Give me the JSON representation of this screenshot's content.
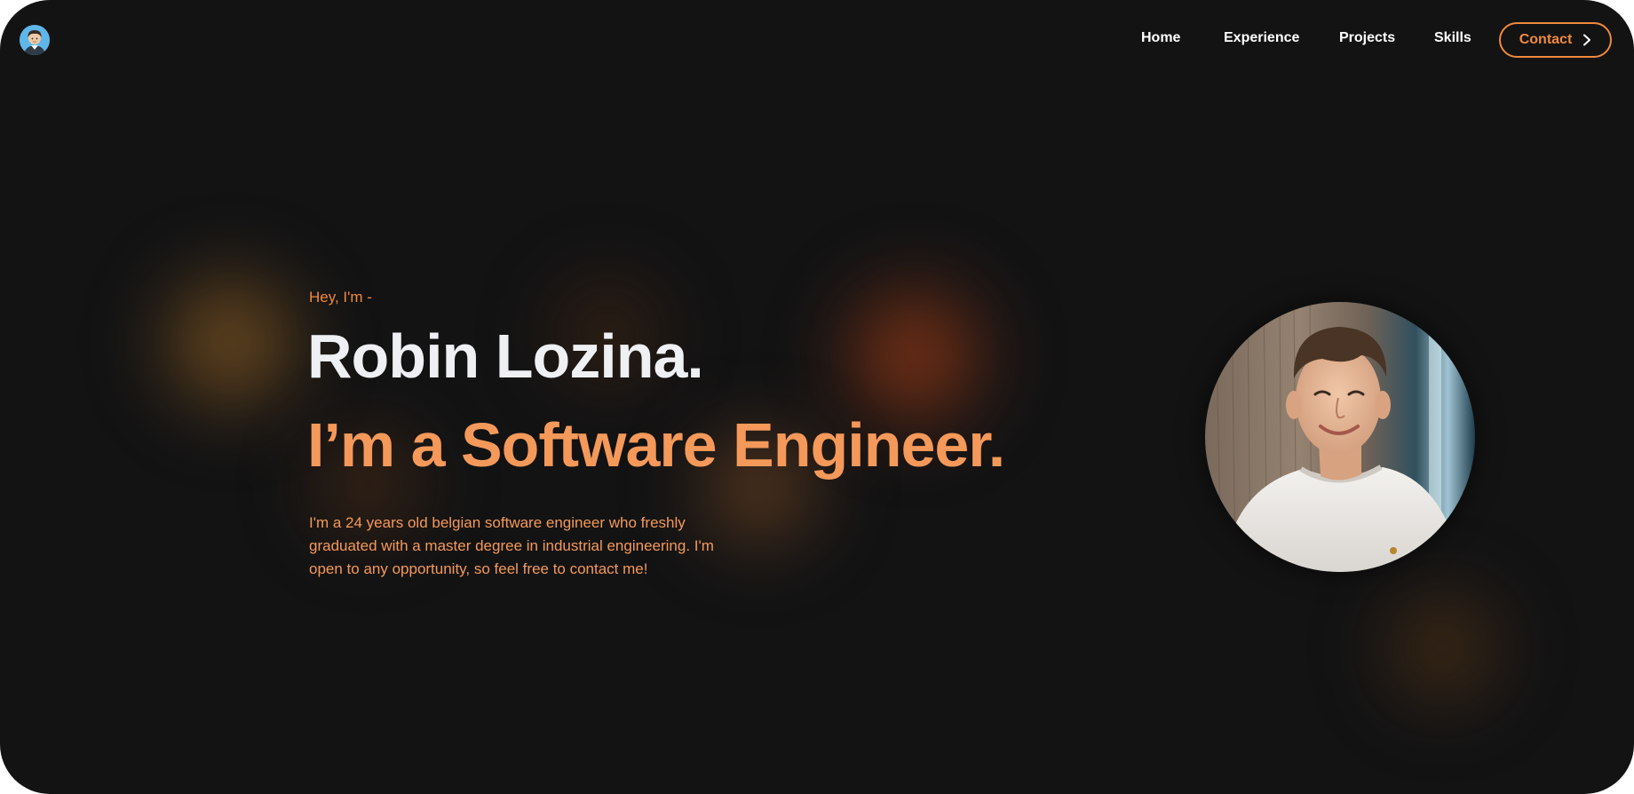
{
  "header": {
    "nav": [
      {
        "label": "Home"
      },
      {
        "label": "Experience"
      },
      {
        "label": "Projects"
      },
      {
        "label": "Skills"
      }
    ],
    "contact_label": "Contact"
  },
  "hero": {
    "greeting": "Hey, I'm -",
    "name": "Robin Lozina.",
    "role": "I’m a Software Engineer.",
    "intro": "I'm a 24 years old belgian software engineer who freshly graduated with a master degree in industrial engineering. I'm open to any opportunity, so feel free to contact me!"
  },
  "colors": {
    "background": "#131314",
    "accent": "#f08a3c",
    "accent_light": "#f4995a",
    "heading": "#eef0f3"
  },
  "icons": {
    "logo": "avatar-logo-icon",
    "contact": "chevron-right-icon"
  }
}
